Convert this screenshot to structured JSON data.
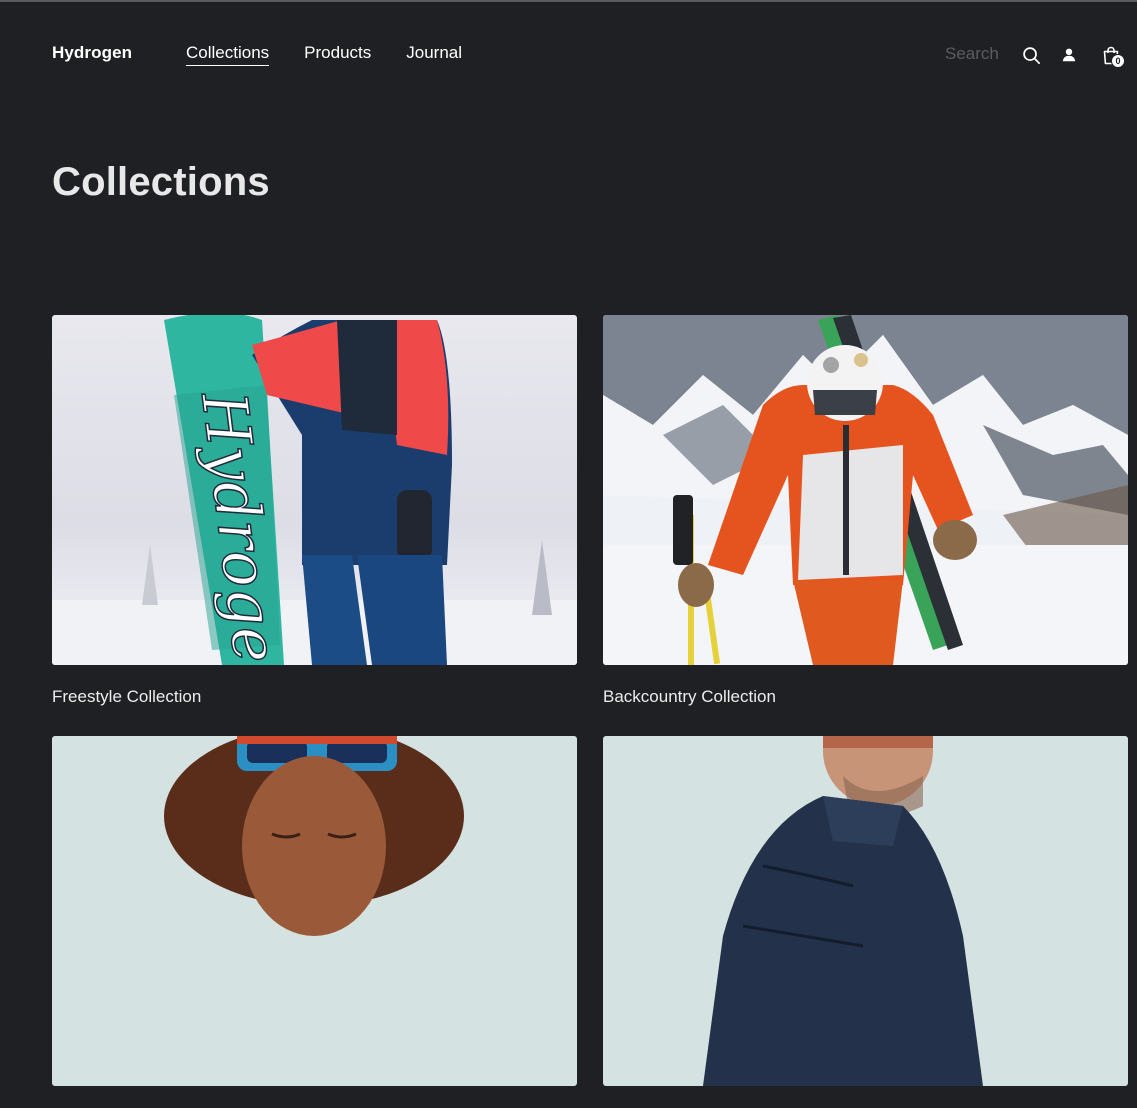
{
  "header": {
    "logo": "Hydrogen",
    "nav": [
      {
        "label": "Collections",
        "active": true
      },
      {
        "label": "Products",
        "active": false
      },
      {
        "label": "Journal",
        "active": false
      }
    ],
    "search_placeholder": "Search",
    "cart_count": "0"
  },
  "main": {
    "title": "Collections",
    "collections": [
      {
        "title": "Freestyle Collection"
      },
      {
        "title": "Backcountry Collection"
      },
      {
        "title": ""
      },
      {
        "title": ""
      }
    ]
  },
  "colors": {
    "background": "#1f2024",
    "text": "#ececec",
    "muted": "#5a5c62"
  }
}
